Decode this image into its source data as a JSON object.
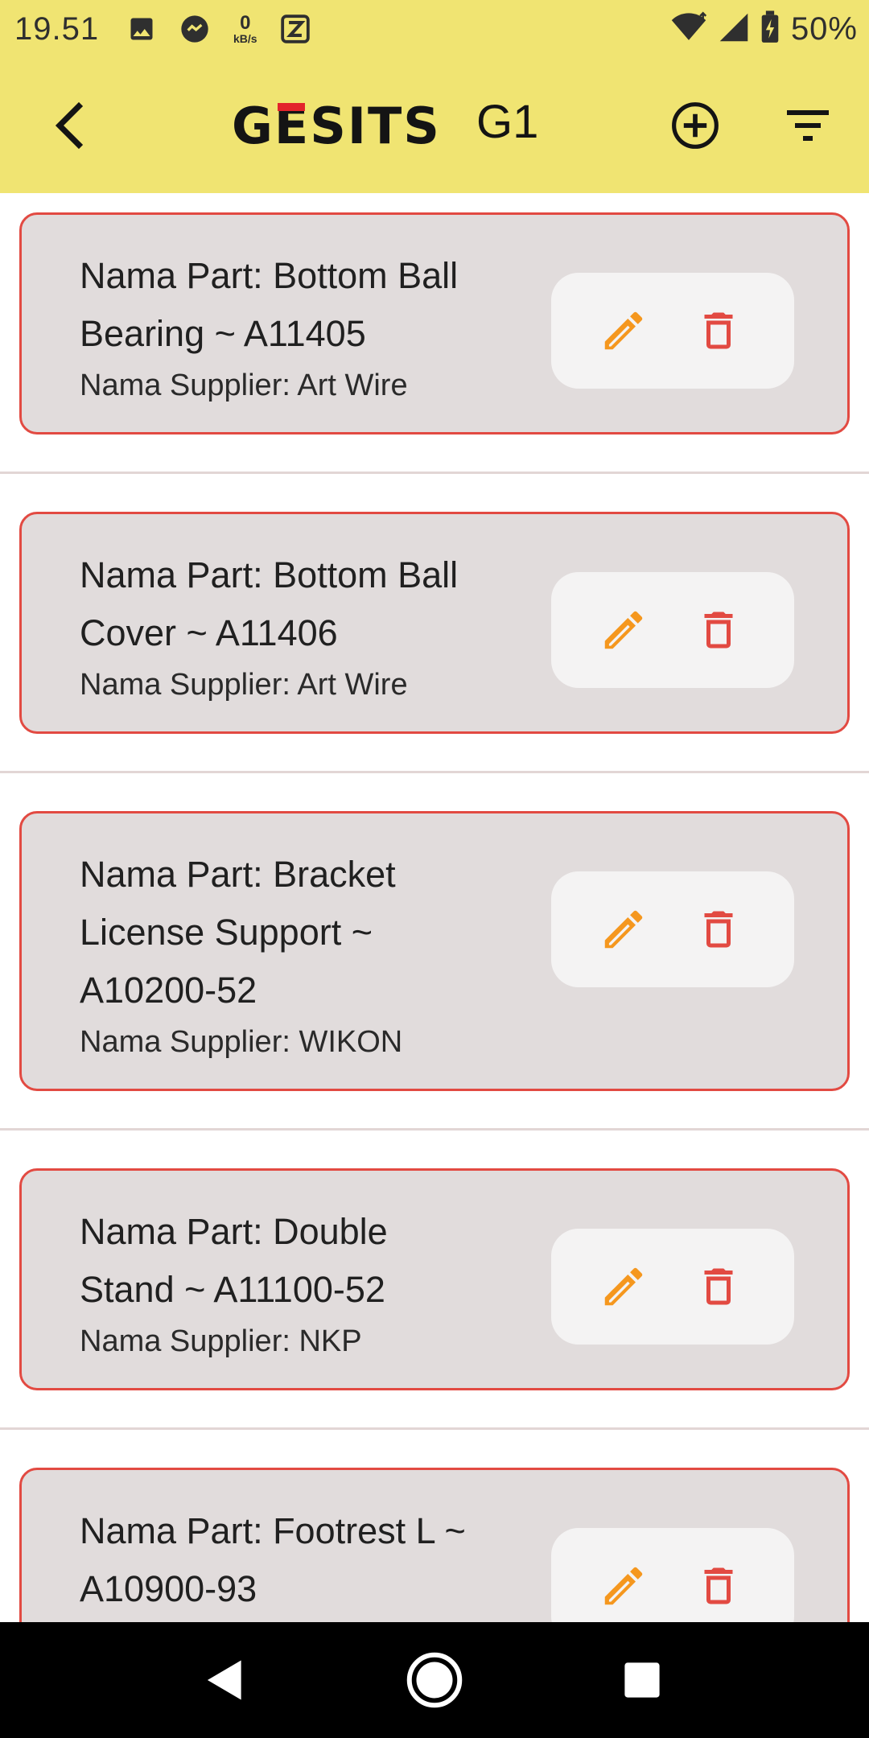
{
  "status_bar": {
    "time": "19.51",
    "data_rate_value": "0",
    "data_rate_unit": "kB/s",
    "battery_percent": "50%",
    "icons": [
      "image-icon",
      "messenger-icon",
      "data-rate-icon",
      "z-app-icon",
      "wifi-icon",
      "cell-signal-icon",
      "battery-icon"
    ]
  },
  "app_bar": {
    "brand": "GESITS",
    "model": "G1",
    "brand_accent_color": "#e3242b",
    "background_color": "#f0e472",
    "icons": [
      "back-arrow-icon",
      "add-circle-icon",
      "filter-icon"
    ]
  },
  "parts": [
    {
      "name_lines": [
        "Nama Part: Bottom Ball",
        "Bearing ~ A11405"
      ],
      "supplier": "Nama Supplier: Art Wire"
    },
    {
      "name_lines": [
        "Nama Part: Bottom Ball",
        "Cover ~ A11406"
      ],
      "supplier": "Nama Supplier: Art Wire"
    },
    {
      "name_lines": [
        "Nama Part: Bracket",
        "License Support ~",
        "A10200-52"
      ],
      "supplier": "Nama Supplier: WIKON"
    },
    {
      "name_lines": [
        "Nama Part: Double",
        "Stand ~ A11100-52"
      ],
      "supplier": "Nama Supplier: NKP"
    },
    {
      "name_lines": [
        "Nama Part: Footrest L ~",
        "A10900-93"
      ],
      "supplier": ""
    }
  ],
  "colors": {
    "card_background": "#e1dcdc",
    "card_border": "#e24a42",
    "edit_icon": "#f5971e",
    "delete_icon": "#e24a42"
  },
  "nav_bar": {
    "icons": [
      "back-triangle-icon",
      "home-circle-icon",
      "recents-square-icon"
    ]
  }
}
